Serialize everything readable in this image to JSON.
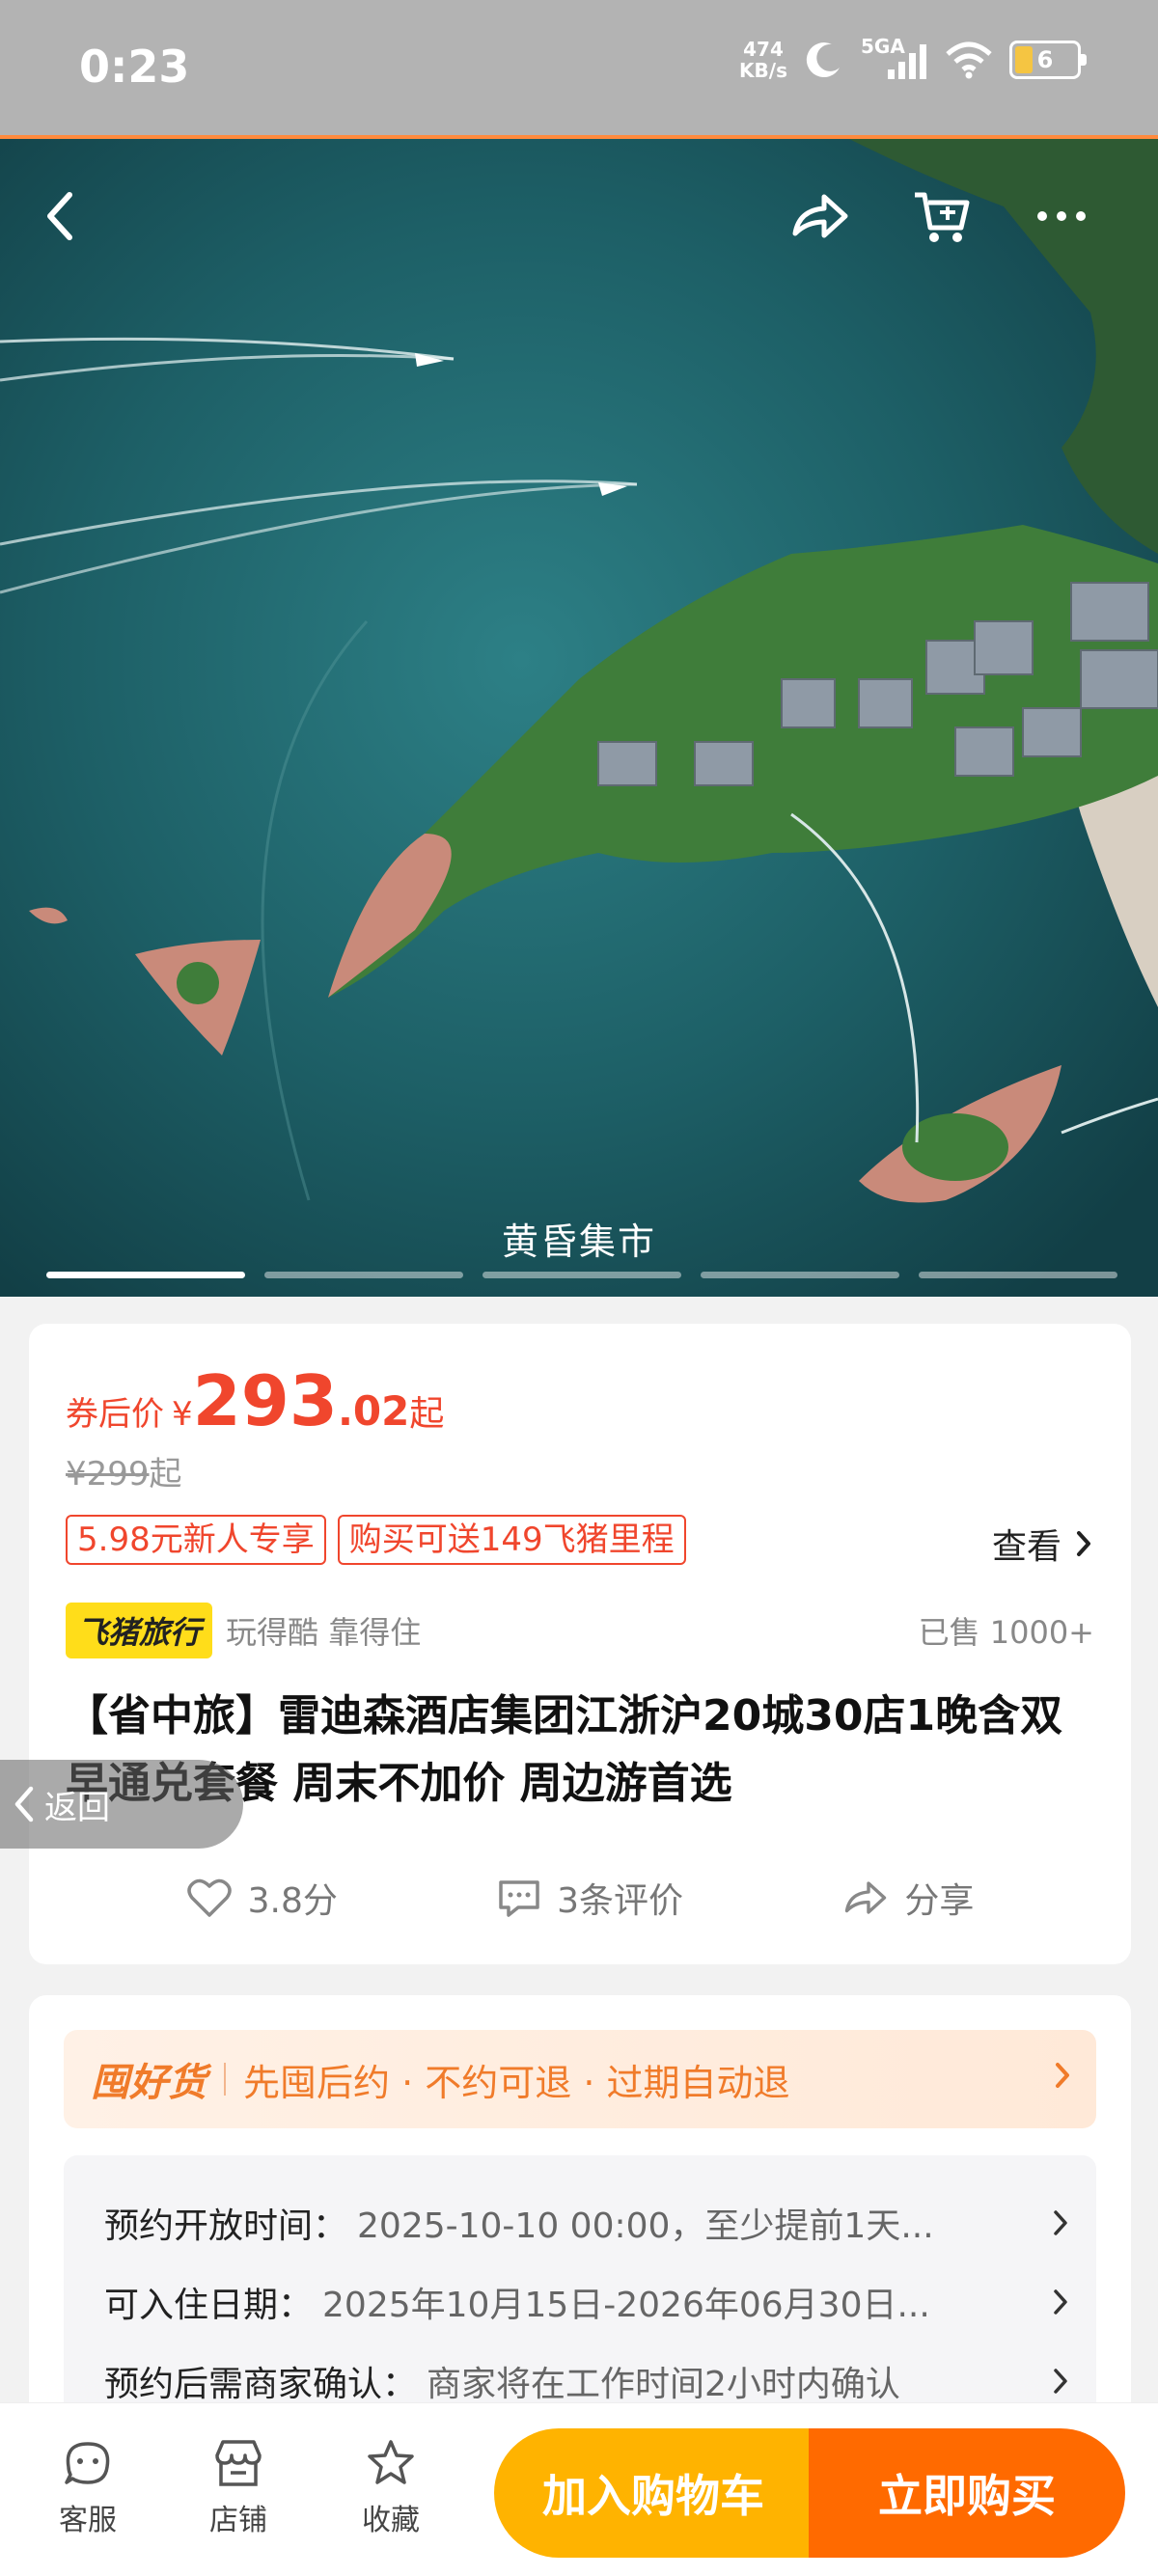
{
  "status_bar": {
    "time": "0:23",
    "net_speed_value": "474",
    "net_speed_unit": "KB/s",
    "signal_label": "5GA",
    "battery": "6"
  },
  "hero": {
    "caption": "黄昏集市",
    "slide_count": 5,
    "active_slide": 1
  },
  "price": {
    "label": "券后价",
    "currency": "¥",
    "integer": "293",
    "decimal": ".02",
    "suffix": "起",
    "original": "¥299",
    "original_suffix": "起"
  },
  "tags": [
    "5.98元新人专享",
    "购买可送149飞猪里程"
  ],
  "view_more": "查看",
  "brand": {
    "logo": "飞猪旅行",
    "slogan": "玩得酷 靠得住",
    "sold": "已售 1000+"
  },
  "title": "【省中旅】雷迪森酒店集团江浙沪20城30店1晚含双早通兑套餐 周末不加价 周边游首选",
  "stats": {
    "rating": "3.8分",
    "reviews": "3条评价",
    "share": "分享"
  },
  "back_float": "返回",
  "promo": {
    "logo": "囤好货",
    "text": "先囤后约 · 不约可退 · 过期自动退"
  },
  "info": [
    {
      "label": "预约开放时间：",
      "value": "2025-10-10 00:00，至少提前1天..."
    },
    {
      "label": "可入住日期：",
      "value": "2025年10月15日-2026年06月30日..."
    },
    {
      "label": "预约后需商家确认：",
      "value": "商家将在工作时间2小时内确认"
    }
  ],
  "bottom_bar": {
    "service": "客服",
    "shop": "店铺",
    "favorite": "收藏",
    "add_cart": "加入购物车",
    "buy_now": "立即购买"
  },
  "colors": {
    "price_red": "#f0462d",
    "cart_yellow": "#ffb300",
    "buy_orange": "#ff6a00",
    "brand_yellow": "#ffdd1a"
  }
}
